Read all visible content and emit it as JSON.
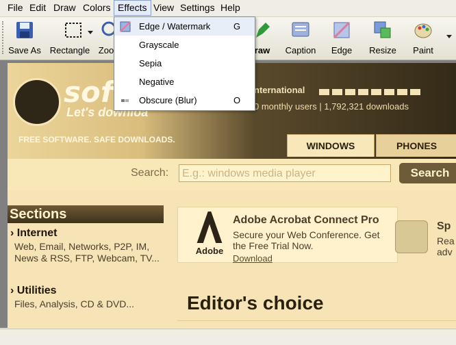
{
  "menubar": {
    "items": [
      "File",
      "Edit",
      "Draw",
      "Colors",
      "Effects",
      "View",
      "Settings",
      "Help"
    ]
  },
  "toolbar": {
    "save_as": "Save As",
    "rectangle": "Rectangle",
    "zoom": "Zoo",
    "draw": "raw",
    "caption": "Caption",
    "edge": "Edge",
    "resize": "Resize",
    "paint": "Paint"
  },
  "effects_menu": {
    "items": [
      {
        "label": "Edge / Watermark",
        "shortcut": "G"
      },
      {
        "label": "Grayscale",
        "shortcut": ""
      },
      {
        "label": "Sepia",
        "shortcut": ""
      },
      {
        "label": "Negative",
        "shortcut": ""
      },
      {
        "label": "Obscure (Blur)",
        "shortcut": "O"
      }
    ]
  },
  "site": {
    "logo_text": "softo",
    "tagline": "Let's downloa",
    "international": "nternational",
    "users": "0 monthly users  |  1,792,321 downloads",
    "slogan": "FREE SOFTWARE. SAFE DOWNLOADS.",
    "tabs": [
      "WINDOWS",
      "PHONES"
    ],
    "search_label": "Search:",
    "search_placeholder": "E.g.: windows media player",
    "search_button": "Search",
    "sections": {
      "title": "Sections",
      "groups": [
        {
          "head": "Internet",
          "text": "Web, Email, Networks, P2P, IM, News & RSS, FTP, Webcam, TV..."
        },
        {
          "head": "Utilities",
          "text": "Files, Analysis, CD & DVD..."
        }
      ]
    },
    "promo": {
      "brand": "Adobe",
      "title": "Adobe Acrobat Connect Pro",
      "desc": "Secure your Web Conference. Get the Free Trial Now.",
      "link": "Download"
    },
    "promo2": {
      "title": "Sp",
      "desc": "Rea adv"
    },
    "editors_choice": "Editor's choice"
  },
  "colors": {
    "accent": "#6e5c38",
    "menu_highlight": "#e6ecf7"
  }
}
